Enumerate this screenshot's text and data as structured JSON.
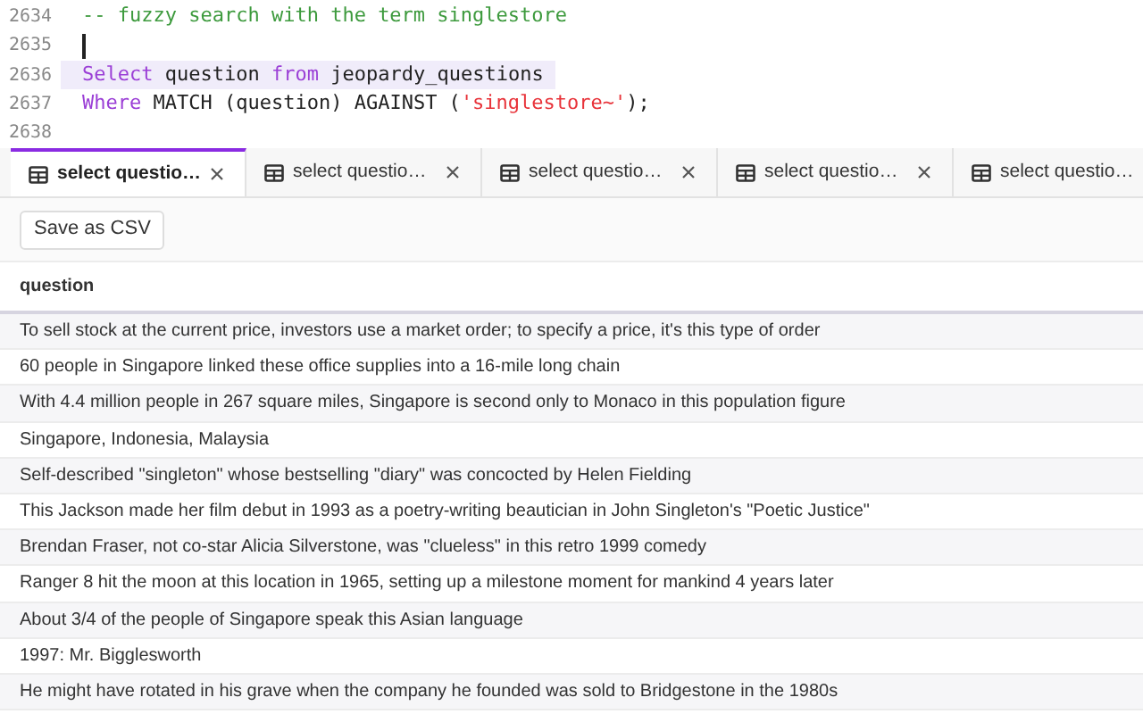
{
  "editor": {
    "lines": [
      {
        "number": "2634",
        "cursor": false,
        "highlighted": false,
        "tokens": [
          {
            "kind": "comment",
            "text": "-- fuzzy search with the term singlestore"
          }
        ]
      },
      {
        "number": "2635",
        "cursor": true,
        "highlighted": false
      },
      {
        "number": "2636",
        "cursor": false,
        "highlighted": true,
        "tokens": [
          {
            "kind": "keyword",
            "text": "Select"
          },
          {
            "kind": "plain",
            "text": " question "
          },
          {
            "kind": "keyword",
            "text": "from"
          },
          {
            "kind": "plain",
            "text": " jeopardy_questions "
          }
        ]
      },
      {
        "number": "2637",
        "cursor": false,
        "highlighted": false,
        "tokens": [
          {
            "kind": "keyword",
            "text": "Where"
          },
          {
            "kind": "plain",
            "text": " MATCH (question) AGAINST ("
          },
          {
            "kind": "string",
            "text": "'singlestore~'"
          },
          {
            "kind": "plain",
            "text": ");"
          }
        ]
      },
      {
        "number": "2638",
        "cursor": false,
        "highlighted": false
      }
    ]
  },
  "tabs": [
    {
      "label": "select questio…",
      "selected": true
    },
    {
      "label": "select questio…",
      "selected": false
    },
    {
      "label": "select questio…",
      "selected": false
    },
    {
      "label": "select questio…",
      "selected": false
    },
    {
      "label": "select questio…",
      "selected": false
    }
  ],
  "toolbar": {
    "button": "Save as CSV"
  },
  "table": {
    "columns": [
      "question"
    ],
    "rows": [
      "To sell stock at the current price, investors use a market order; to specify a price, it's this type of order",
      "60 people in Singapore linked these office supplies into a 16-mile long chain",
      "With 4.4 million people in 267 square miles, Singapore is second only to Monaco in this population figure",
      "Singapore, Indonesia, Malaysia",
      "Self-described \"singleton\" whose bestselling \"diary\" was concocted by Helen Fielding",
      "This Jackson made her film debut in 1993 as a poetry-writing beautician in John Singleton's \"Poetic Justice\"",
      "Brendan Fraser, not co-star Alicia Silverstone, was \"clueless\" in this retro 1999 comedy",
      "Ranger 8 hit the moon at this location in 1965, setting up a milestone moment for mankind 4 years later",
      "About 3/4 of the people of Singapore speak this Asian language",
      "1997: Mr. Bigglesworth",
      "He might have rotated in his grave when the company he founded was sold to Bridgestone in the 1980s"
    ]
  }
}
